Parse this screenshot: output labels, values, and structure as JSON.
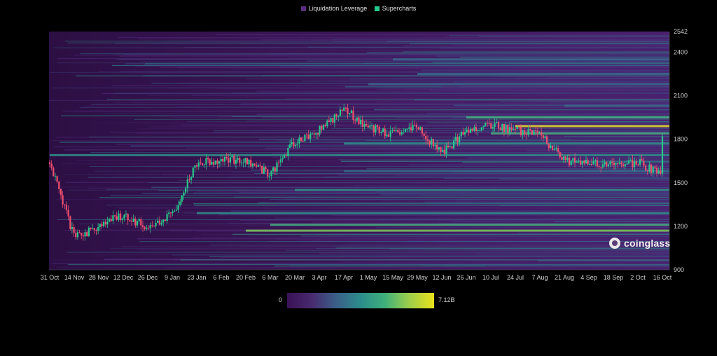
{
  "legend": {
    "items": [
      {
        "label": "Liquidation Leverage",
        "color": "#5b2d82"
      },
      {
        "label": "Supercharts",
        "color": "#26c98b"
      }
    ]
  },
  "watermark": {
    "text": "coinglass"
  },
  "colors": {
    "background": "#000000",
    "plot_base": "#3a1552",
    "candle_up": "#26c98b",
    "candle_down": "#f0506e"
  },
  "color_scale": {
    "min_label": "0",
    "max_label": "7.12B"
  },
  "chart_data": {
    "type": "heatmap",
    "title": "",
    "xlabel": "",
    "ylabel": "",
    "x_ticks": [
      "31 Oct",
      "14 Nov",
      "28 Nov",
      "12 Dec",
      "26 Dec",
      "9 Jan",
      "23 Jan",
      "6 Feb",
      "20 Feb",
      "6 Mar",
      "20 Mar",
      "3 Apr",
      "17 Apr",
      "1 May",
      "15 May",
      "29 May",
      "12 Jun",
      "26 Jun",
      "10 Jul",
      "24 Jul",
      "7 Aug",
      "21 Aug",
      "4 Sep",
      "18 Sep",
      "2 Oct",
      "16 Oct"
    ],
    "y_ticks": [
      900,
      1200,
      1500,
      1800,
      2100,
      2400,
      2542
    ],
    "ylim": [
      900,
      2542
    ],
    "grid": false,
    "legend_position": "top-center",
    "price_series": {
      "name": "Supercharts",
      "values_by_tick": [
        1640,
        1120,
        1200,
        1280,
        1190,
        1280,
        1640,
        1660,
        1650,
        1560,
        1780,
        1860,
        2010,
        1880,
        1830,
        1880,
        1700,
        1860,
        1900,
        1860,
        1830,
        1650,
        1630,
        1620,
        1640,
        1560
      ],
      "end_value": 1790
    },
    "liquidation_bands": [
      {
        "price": 1170,
        "start_tick": 8,
        "intensity": 0.72
      },
      {
        "price": 1210,
        "start_tick": 9,
        "intensity": 0.5
      },
      {
        "price": 1290,
        "start_tick": 6,
        "intensity": 0.45
      },
      {
        "price": 1450,
        "start_tick": 10,
        "intensity": 0.35
      },
      {
        "price": 1580,
        "start_tick": 12,
        "intensity": 0.32
      },
      {
        "price": 1690,
        "start_tick": 0,
        "intensity": 0.4
      },
      {
        "price": 1770,
        "start_tick": 12,
        "intensity": 0.45
      },
      {
        "price": 1840,
        "start_tick": 18,
        "intensity": 0.55
      },
      {
        "price": 1890,
        "start_tick": 19,
        "intensity": 0.95
      },
      {
        "price": 1950,
        "start_tick": 17,
        "intensity": 0.5
      },
      {
        "price": 2030,
        "start_tick": 21,
        "intensity": 0.3
      },
      {
        "price": 2180,
        "start_tick": 13,
        "intensity": 0.25
      },
      {
        "price": 2250,
        "start_tick": 15,
        "intensity": 0.22
      },
      {
        "price": 2350,
        "start_tick": 14,
        "intensity": 0.18
      }
    ]
  }
}
